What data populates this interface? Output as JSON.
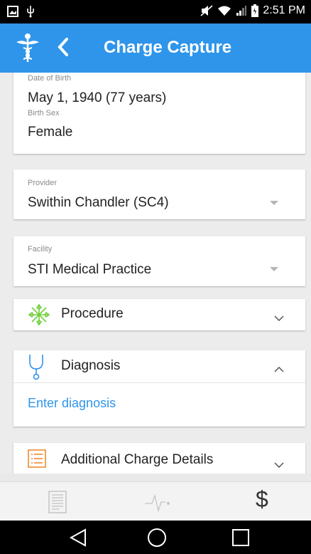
{
  "status_bar": {
    "time": "2:51 PM",
    "icons": [
      "gallery-icon",
      "usb-icon",
      "mute-icon",
      "wifi-icon",
      "signal-icon",
      "battery-icon"
    ]
  },
  "app_bar": {
    "title": "Charge Capture",
    "logo_icon": "caduceus-icon",
    "back_icon": "chevron-left-icon",
    "color": "#2f95ea"
  },
  "patient": {
    "dob_label": "Date of Birth",
    "dob_value": "May 1, 1940 (77 years)",
    "sex_label": "Birth Sex",
    "sex_value": "Female"
  },
  "provider": {
    "label": "Provider",
    "value": "Swithin Chandler (SC4)"
  },
  "facility": {
    "label": "Facility",
    "value": "STI Medical Practice"
  },
  "sections": {
    "procedure": {
      "label": "Procedure",
      "icon": "procedure-star-icon",
      "expanded": false
    },
    "diagnosis": {
      "label": "Diagnosis",
      "icon": "stethoscope-icon",
      "expanded": true,
      "action": "Enter diagnosis"
    },
    "additional": {
      "label": "Additional Charge Details",
      "icon": "list-icon",
      "expanded": false
    }
  },
  "bottom_nav": {
    "items": [
      "document-icon",
      "vitals-icon",
      "dollar-icon"
    ],
    "dollar_label": "$"
  },
  "system_nav": [
    "back-triangle-icon",
    "home-circle-icon",
    "recents-square-icon"
  ]
}
